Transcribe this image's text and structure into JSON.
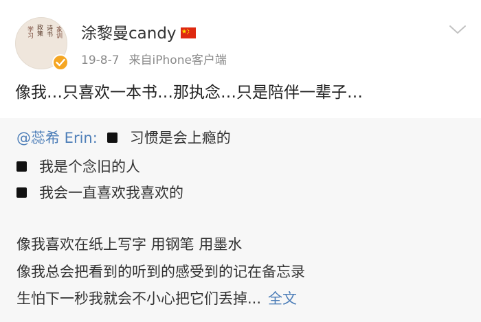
{
  "post": {
    "avatar_text": [
      "学习",
      "政策",
      "诗书",
      "家训"
    ],
    "username": "涂黎曼candy",
    "date": "19-8-7",
    "source": "来自iPhone客户端",
    "content": "像我…只喜欢一本书…那执念…只是陪伴一辈子…",
    "flag_icon": "china-flag-icon",
    "badge_icon": "verified-badge-icon",
    "menu_icon": "chevron-down-icon"
  },
  "repost": {
    "mention": "@蕊希 Erin:",
    "line1": "习惯是会上瘾的",
    "line2": "我是个念旧的人",
    "line3": "我会一直喜欢我喜欢的",
    "line4": "像我喜欢在纸上写字 用钢笔 用墨水",
    "line5": "像我总会把看到的听到的感受到的记在备忘录",
    "line6": "生怕下一秒我就会不小心把它们丢掉...",
    "full_text_link": "全文"
  },
  "colors": {
    "link": "#4d7eb8",
    "meta": "#8a8a8a",
    "repost_bg": "#f7f7f7",
    "badge": "#f5a623",
    "flag": "#de2910"
  }
}
